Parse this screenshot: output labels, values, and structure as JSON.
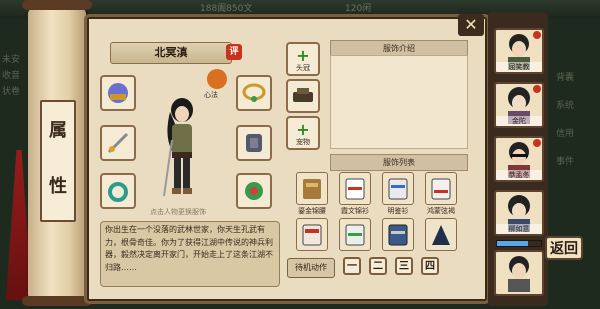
{
  "background": {
    "top_stats": [
      "188阖850文",
      "120闲"
    ],
    "left_menu": [
      "未安",
      "收音",
      "状卷"
    ],
    "right_menu": [
      "背囊",
      "系统",
      "信用",
      "事件"
    ]
  },
  "scroll": {
    "chars": [
      "属",
      "性"
    ]
  },
  "character": {
    "name": "北冥滇",
    "eval_badge": "评",
    "mini_label": "心法",
    "hint": "点击人物更换服饰"
  },
  "intro_text": "你出生在一个没落的武林世家，你天生孔武有力，根骨奇佳。你为了获得江湖中传说的神兵利器，毅然决定离开家门，开始走上了这条江湖不归路……",
  "side_buttons": [
    {
      "label": "头冠",
      "icon": "plus-icon"
    },
    {
      "label": "",
      "icon": "hat-icon"
    },
    {
      "label": "宠物",
      "icon": "plus-icon"
    }
  ],
  "sections": {
    "intro_title": "服饰介绍",
    "list_title": "服饰列表"
  },
  "costumes": [
    {
      "label": "鎏金锦腰"
    },
    {
      "label": "霞文锦衫"
    },
    {
      "label": "明鉴衫"
    },
    {
      "label": "鸿蒙弦褐"
    },
    {
      "label": ""
    },
    {
      "label": ""
    },
    {
      "label": ""
    },
    {
      "label": ""
    }
  ],
  "idle_button": "待机动作",
  "pages": [
    "一",
    "二",
    "三",
    "四"
  ],
  "roster": [
    {
      "name": "屈笑教"
    },
    {
      "name": "金陀"
    },
    {
      "name": "恭孟冬"
    },
    {
      "name": "柳如意"
    },
    {
      "name": ""
    }
  ],
  "hp_fraction": 0.7,
  "back_label": "返回",
  "colors": {
    "accent_red": "#c9331d",
    "frame_brown": "#7b5e3f",
    "parchment": "#e9dcc1"
  }
}
